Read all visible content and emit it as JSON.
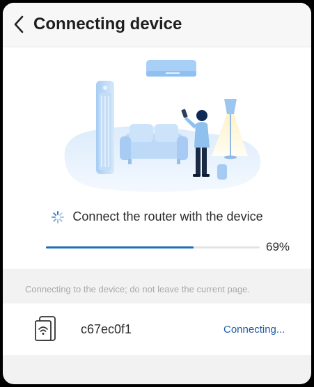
{
  "header": {
    "title": "Connecting device",
    "back_icon": "chevron-left-icon"
  },
  "progress": {
    "message": "Connect the router with the device",
    "percent": 69,
    "percent_label": "69%",
    "spinner_icon": "loading-spinner-icon"
  },
  "notice": "Connecting to the device; do not leave the current page.",
  "device": {
    "name": "c67ec0f1",
    "status": "Connecting...",
    "icon": "wifi-device-icon"
  },
  "colors": {
    "accent": "#1e6fb8",
    "link": "#1e5aa5",
    "background": "#f2f2f2"
  }
}
